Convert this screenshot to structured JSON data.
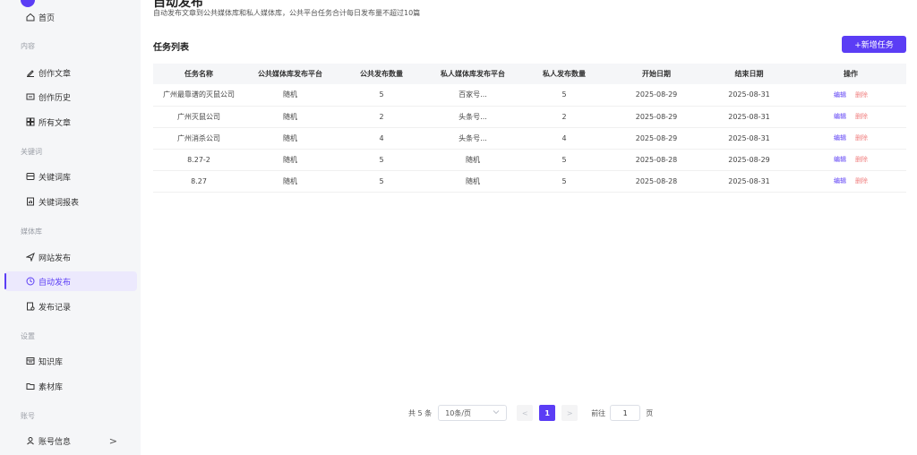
{
  "sidebar": {
    "items": [
      {
        "label": "首页"
      },
      {
        "label": "创作文章"
      },
      {
        "label": "创作历史"
      },
      {
        "label": "所有文章"
      },
      {
        "label": "关键词库"
      },
      {
        "label": "关键词报表"
      },
      {
        "label": "网站发布"
      },
      {
        "label": "自动发布"
      },
      {
        "label": "发布记录"
      },
      {
        "label": "知识库"
      },
      {
        "label": "素材库"
      },
      {
        "label": "账号信息"
      }
    ],
    "sections": [
      "内容",
      "关键词",
      "媒体库",
      "设置",
      "账号"
    ],
    "chevron": ">"
  },
  "page": {
    "title": "自动发布",
    "description": "自动发布文章到公共媒体库和私人媒体库，公共平台任务合计每日发布量不超过10篇"
  },
  "task_list": {
    "title": "任务列表",
    "add_button": "+新增任务",
    "columns": [
      "任务名称",
      "公共媒体库发布平台",
      "公共发布数量",
      "私人媒体库发布平台",
      "私人发布数量",
      "开始日期",
      "结束日期",
      "操作"
    ],
    "rows": [
      {
        "name": "广州最靠谱的灭鼠公司",
        "public_platform": "随机",
        "public_count": "5",
        "private_platform": "百家号...",
        "private_count": "5",
        "start": "2025-08-29",
        "end": "2025-08-31",
        "edit": "编辑",
        "delete": "删除"
      },
      {
        "name": "广州灭鼠公司",
        "public_platform": "随机",
        "public_count": "2",
        "private_platform": "头条号...",
        "private_count": "2",
        "start": "2025-08-29",
        "end": "2025-08-31",
        "edit": "编辑",
        "delete": "删除"
      },
      {
        "name": "广州消杀公司",
        "public_platform": "随机",
        "public_count": "4",
        "private_platform": "头条号...",
        "private_count": "4",
        "start": "2025-08-29",
        "end": "2025-08-31",
        "edit": "编辑",
        "delete": "删除"
      },
      {
        "name": "8.27-2",
        "public_platform": "随机",
        "public_count": "5",
        "private_platform": "随机",
        "private_count": "5",
        "start": "2025-08-28",
        "end": "2025-08-29",
        "edit": "编辑",
        "delete": "删除"
      },
      {
        "name": "8.27",
        "public_platform": "随机",
        "public_count": "5",
        "private_platform": "随机",
        "private_count": "5",
        "start": "2025-08-28",
        "end": "2025-08-31",
        "edit": "编辑",
        "delete": "删除"
      }
    ]
  },
  "pagination": {
    "total": "共 5 条",
    "page_size": "10条/页",
    "prev": "<",
    "current": "1",
    "next": ">",
    "goto_label": "前往",
    "goto_value": "1",
    "page_suffix": "页"
  },
  "colors": {
    "accent": "#5b3df5",
    "delete": "#f08080",
    "sidebar_bg": "#f5f6f8",
    "active_bg": "#ece9fd"
  }
}
